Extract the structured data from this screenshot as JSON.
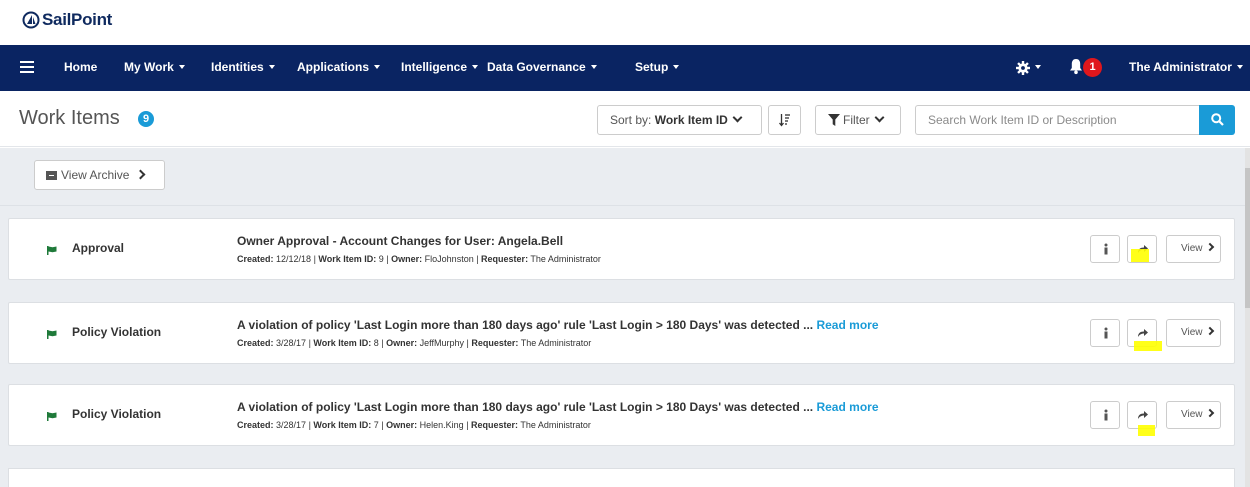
{
  "brand": {
    "name": "SailPoint"
  },
  "nav": {
    "items": [
      {
        "label": "Home",
        "dropdown": false
      },
      {
        "label": "My Work",
        "dropdown": true
      },
      {
        "label": "Identities",
        "dropdown": true
      },
      {
        "label": "Applications",
        "dropdown": true
      },
      {
        "label": "Intelligence",
        "dropdown": true
      },
      {
        "label": "Data Governance",
        "dropdown": true
      },
      {
        "label": "Setup",
        "dropdown": true
      }
    ],
    "notification_count": "1",
    "user_label": "The Administrator"
  },
  "header": {
    "title": "Work Items",
    "count": "9",
    "sort_prefix": "Sort by:",
    "sort_value": "Work Item ID",
    "filter_label": "Filter",
    "search_placeholder": "Search Work Item ID or Description"
  },
  "archive": {
    "label": "View Archive"
  },
  "items": [
    {
      "type": "Approval",
      "description": "Owner Approval - Account Changes for User: Angela.Bell",
      "read_more": "",
      "created_label": "Created:",
      "created": "12/12/18",
      "id_label": "Work Item ID:",
      "id": "9",
      "owner_label": "Owner:",
      "owner": "FloJohnston",
      "requester_label": "Requester:",
      "requester": "The Administrator",
      "view_label": "View"
    },
    {
      "type": "Policy Violation",
      "description": "A violation of policy 'Last Login more than 180 days ago' rule 'Last Login > 180 Days' was detected ...",
      "read_more": "Read more",
      "created_label": "Created:",
      "created": "3/28/17",
      "id_label": "Work Item ID:",
      "id": "8",
      "owner_label": "Owner:",
      "owner": "JeffMurphy",
      "requester_label": "Requester:",
      "requester": "The Administrator",
      "view_label": "View"
    },
    {
      "type": "Policy Violation",
      "description": "A violation of policy 'Last Login more than 180 days ago' rule 'Last Login > 180 Days' was detected ...",
      "read_more": "Read more",
      "created_label": "Created:",
      "created": "3/28/17",
      "id_label": "Work Item ID:",
      "id": "7",
      "owner_label": "Owner:",
      "owner": "Helen.King",
      "requester_label": "Requester:",
      "requester": "The Administrator",
      "view_label": "View"
    }
  ],
  "colors": {
    "nav_bg": "#0a2462",
    "accent": "#1a9bd7",
    "notification": "#e0171d",
    "flag": "#1f7a3a",
    "highlight": "#ffff00",
    "content_bg": "#eaedf1"
  },
  "icons": {
    "menu": "hamburger-icon",
    "settings": "gear-icon",
    "notifications": "bell-icon",
    "sort_order": "sort-order-icon",
    "filter": "funnel-icon",
    "search": "search-icon",
    "archive": "archive-box-icon",
    "item_type": "flag-icon",
    "details": "info-icon",
    "forward": "forward-arrow-icon"
  }
}
